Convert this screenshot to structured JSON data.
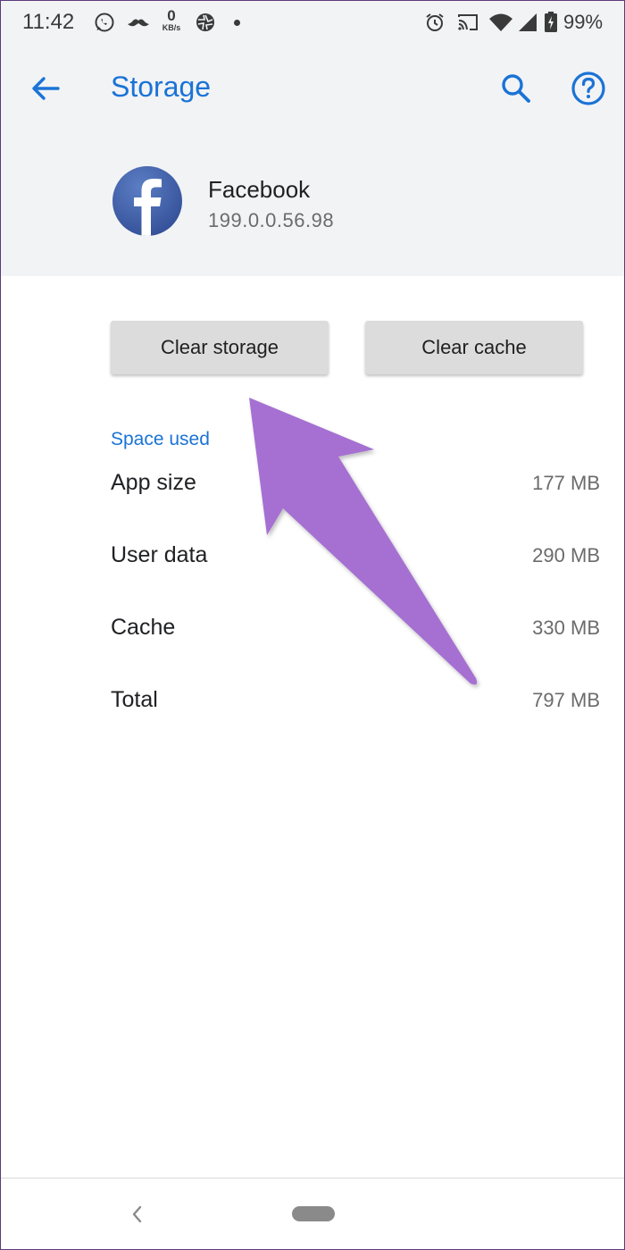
{
  "status_bar": {
    "time": "11:42",
    "network_speed_value": "0",
    "network_speed_unit": "KB/s",
    "battery_percent": "99%",
    "icons": [
      "whatsapp-icon",
      "mustache-icon",
      "network-speed-indicator",
      "aperture-icon",
      "notification-dot",
      "alarm-icon",
      "cast-icon",
      "wifi-icon",
      "cell-signal-icon",
      "battery-icon"
    ]
  },
  "app_bar": {
    "title": "Storage",
    "back_icon": "arrow-back-icon",
    "search_icon": "search-icon",
    "help_icon": "help-icon"
  },
  "app_info": {
    "name": "Facebook",
    "version": "199.0.0.56.98",
    "icon": "facebook-logo"
  },
  "actions": {
    "clear_storage": "Clear storage",
    "clear_cache": "Clear cache"
  },
  "space_used": {
    "heading": "Space used",
    "rows": [
      {
        "label": "App size",
        "value": "177 MB"
      },
      {
        "label": "User data",
        "value": "290 MB"
      },
      {
        "label": "Cache",
        "value": "330 MB"
      },
      {
        "label": "Total",
        "value": "797 MB"
      }
    ]
  },
  "annotation": {
    "arrow_color": "#a56fd2"
  },
  "colors": {
    "accent": "#1a73d6",
    "header_bg": "#f2f3f5",
    "button_bg": "#dcdcdc"
  },
  "nav_bar": {
    "back_icon": "nav-back-icon",
    "home_icon": "home-pill-icon"
  }
}
